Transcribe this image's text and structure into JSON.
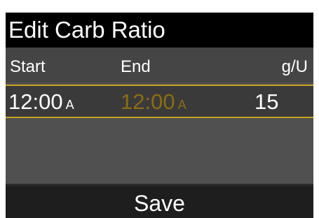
{
  "title": "Edit Carb Ratio",
  "columns": {
    "start": "Start",
    "end": "End",
    "unit": "g/U"
  },
  "rows": [
    {
      "start_time": "12:00",
      "start_ampm": "A",
      "end_time": "12:00",
      "end_ampm": "A",
      "ratio": "15"
    }
  ],
  "save_label": "Save",
  "colors": {
    "title_bar": "#000000",
    "screen_bg": "#505050",
    "header_bg": "#454545",
    "selected_row_bg": "#3a3a3a",
    "selection_border": "#c8a020",
    "end_time_text": "#8c6d12",
    "save_bar": "#1e1e1e",
    "text": "#ffffff"
  }
}
